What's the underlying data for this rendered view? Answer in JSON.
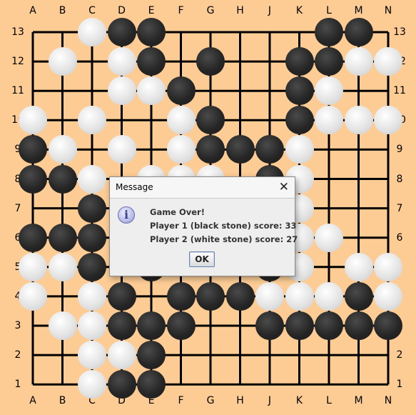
{
  "board": {
    "columns": [
      "A",
      "B",
      "C",
      "D",
      "E",
      "F",
      "G",
      "H",
      "J",
      "K",
      "L",
      "M",
      "N"
    ],
    "rows": [
      "13",
      "12",
      "11",
      "10",
      "9",
      "8",
      "7",
      "6",
      "5",
      "4",
      "3",
      "2",
      "1"
    ],
    "line_color": "#000000",
    "background_color": "#fdcc95",
    "stones": [
      {
        "col": "C",
        "row": 13,
        "color": "white"
      },
      {
        "col": "D",
        "row": 13,
        "color": "black"
      },
      {
        "col": "E",
        "row": 13,
        "color": "black"
      },
      {
        "col": "L",
        "row": 13,
        "color": "black"
      },
      {
        "col": "M",
        "row": 13,
        "color": "black"
      },
      {
        "col": "B",
        "row": 12,
        "color": "white"
      },
      {
        "col": "D",
        "row": 12,
        "color": "white"
      },
      {
        "col": "E",
        "row": 12,
        "color": "black"
      },
      {
        "col": "G",
        "row": 12,
        "color": "black"
      },
      {
        "col": "K",
        "row": 12,
        "color": "black"
      },
      {
        "col": "L",
        "row": 12,
        "color": "black"
      },
      {
        "col": "M",
        "row": 12,
        "color": "white"
      },
      {
        "col": "N",
        "row": 12,
        "color": "white"
      },
      {
        "col": "D",
        "row": 11,
        "color": "white"
      },
      {
        "col": "E",
        "row": 11,
        "color": "white"
      },
      {
        "col": "F",
        "row": 11,
        "color": "black"
      },
      {
        "col": "K",
        "row": 11,
        "color": "black"
      },
      {
        "col": "L",
        "row": 11,
        "color": "white"
      },
      {
        "col": "A",
        "row": 10,
        "color": "white"
      },
      {
        "col": "C",
        "row": 10,
        "color": "white"
      },
      {
        "col": "F",
        "row": 10,
        "color": "white"
      },
      {
        "col": "G",
        "row": 10,
        "color": "black"
      },
      {
        "col": "K",
        "row": 10,
        "color": "black"
      },
      {
        "col": "L",
        "row": 10,
        "color": "white"
      },
      {
        "col": "M",
        "row": 10,
        "color": "white"
      },
      {
        "col": "N",
        "row": 10,
        "color": "white"
      },
      {
        "col": "A",
        "row": 9,
        "color": "black"
      },
      {
        "col": "B",
        "row": 9,
        "color": "white"
      },
      {
        "col": "D",
        "row": 9,
        "color": "white"
      },
      {
        "col": "F",
        "row": 9,
        "color": "white"
      },
      {
        "col": "G",
        "row": 9,
        "color": "black"
      },
      {
        "col": "H",
        "row": 9,
        "color": "black"
      },
      {
        "col": "J",
        "row": 9,
        "color": "black"
      },
      {
        "col": "K",
        "row": 9,
        "color": "white"
      },
      {
        "col": "A",
        "row": 8,
        "color": "black"
      },
      {
        "col": "B",
        "row": 8,
        "color": "black"
      },
      {
        "col": "C",
        "row": 8,
        "color": "white"
      },
      {
        "col": "E",
        "row": 8,
        "color": "white"
      },
      {
        "col": "F",
        "row": 8,
        "color": "white"
      },
      {
        "col": "G",
        "row": 8,
        "color": "white"
      },
      {
        "col": "J",
        "row": 8,
        "color": "black"
      },
      {
        "col": "K",
        "row": 8,
        "color": "white"
      },
      {
        "col": "C",
        "row": 7,
        "color": "black"
      },
      {
        "col": "K",
        "row": 7,
        "color": "white"
      },
      {
        "col": "A",
        "row": 6,
        "color": "black"
      },
      {
        "col": "B",
        "row": 6,
        "color": "black"
      },
      {
        "col": "C",
        "row": 6,
        "color": "black"
      },
      {
        "col": "K",
        "row": 6,
        "color": "white"
      },
      {
        "col": "L",
        "row": 6,
        "color": "white"
      },
      {
        "col": "A",
        "row": 5,
        "color": "white"
      },
      {
        "col": "B",
        "row": 5,
        "color": "white"
      },
      {
        "col": "C",
        "row": 5,
        "color": "black"
      },
      {
        "col": "E",
        "row": 5,
        "color": "black"
      },
      {
        "col": "J",
        "row": 5,
        "color": "black"
      },
      {
        "col": "K",
        "row": 5,
        "color": "white"
      },
      {
        "col": "M",
        "row": 5,
        "color": "white"
      },
      {
        "col": "N",
        "row": 5,
        "color": "white"
      },
      {
        "col": "A",
        "row": 4,
        "color": "white"
      },
      {
        "col": "C",
        "row": 4,
        "color": "white"
      },
      {
        "col": "D",
        "row": 4,
        "color": "black"
      },
      {
        "col": "F",
        "row": 4,
        "color": "black"
      },
      {
        "col": "G",
        "row": 4,
        "color": "black"
      },
      {
        "col": "H",
        "row": 4,
        "color": "black"
      },
      {
        "col": "J",
        "row": 4,
        "color": "white"
      },
      {
        "col": "K",
        "row": 4,
        "color": "white"
      },
      {
        "col": "L",
        "row": 4,
        "color": "white"
      },
      {
        "col": "M",
        "row": 4,
        "color": "black"
      },
      {
        "col": "N",
        "row": 4,
        "color": "white"
      },
      {
        "col": "B",
        "row": 3,
        "color": "white"
      },
      {
        "col": "C",
        "row": 3,
        "color": "white"
      },
      {
        "col": "D",
        "row": 3,
        "color": "black"
      },
      {
        "col": "E",
        "row": 3,
        "color": "black"
      },
      {
        "col": "F",
        "row": 3,
        "color": "black"
      },
      {
        "col": "J",
        "row": 3,
        "color": "black"
      },
      {
        "col": "K",
        "row": 3,
        "color": "black"
      },
      {
        "col": "L",
        "row": 3,
        "color": "black"
      },
      {
        "col": "M",
        "row": 3,
        "color": "black"
      },
      {
        "col": "N",
        "row": 3,
        "color": "black"
      },
      {
        "col": "C",
        "row": 2,
        "color": "white"
      },
      {
        "col": "D",
        "row": 2,
        "color": "white"
      },
      {
        "col": "E",
        "row": 2,
        "color": "black"
      },
      {
        "col": "C",
        "row": 1,
        "color": "white"
      },
      {
        "col": "D",
        "row": 1,
        "color": "black"
      },
      {
        "col": "E",
        "row": 1,
        "color": "black"
      }
    ]
  },
  "dialog": {
    "title": "Message",
    "close_glyph": "✕",
    "icon": "info-icon",
    "icon_glyph": "i",
    "heading": "Game Over!",
    "line1": "Player 1 (black stone) score: 33",
    "line2": "Player 2 (white stone) score: 27",
    "ok_label": "OK"
  }
}
